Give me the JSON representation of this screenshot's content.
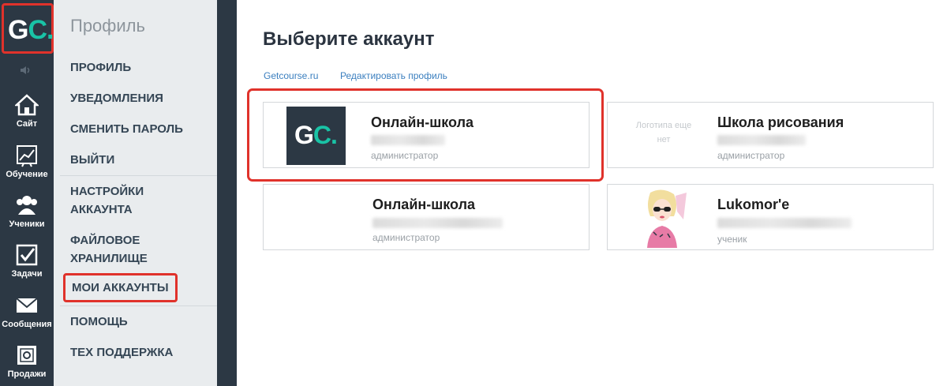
{
  "brand": {
    "logo_g": "G",
    "logo_c": "C",
    "logo_dot": ".",
    "accent": "#19c3a6",
    "highlight": "#e0322b"
  },
  "iconbar": {
    "items": [
      {
        "label": "Сайт",
        "icon": "home-icon"
      },
      {
        "label": "Обучение",
        "icon": "chart-icon"
      },
      {
        "label": "Ученики",
        "icon": "users-icon"
      },
      {
        "label": "Задачи",
        "icon": "checkbox-icon"
      },
      {
        "label": "Сообщения",
        "icon": "envelope-icon"
      },
      {
        "label": "Продажи",
        "icon": "safe-icon"
      }
    ]
  },
  "submenu": {
    "title": "Профиль",
    "items": [
      {
        "label": "ПРОФИЛЬ"
      },
      {
        "label": "УВЕДОМЛЕНИЯ"
      },
      {
        "label": "СМЕНИТЬ ПАРОЛЬ"
      },
      {
        "label": "ВЫЙТИ"
      },
      {
        "label": "НАСТРОЙКИ АККАУНТА"
      },
      {
        "label": "ФАЙЛОВОЕ ХРАНИЛИЩЕ"
      },
      {
        "label": "МОИ АККАУНТЫ"
      },
      {
        "label": "ПОМОЩЬ"
      },
      {
        "label": "ТЕХ ПОДДЕРЖКА"
      }
    ]
  },
  "main": {
    "title": "Выберите аккаунт",
    "links": [
      "Getcourse.ru",
      "Редактировать профиль"
    ],
    "accounts": [
      {
        "title": "Онлайн-школа",
        "role": "администратор",
        "logo": "gc-logo"
      },
      {
        "title": "Школа рисования",
        "role": "администратор",
        "logo_placeholder": "Логотипа еще нет"
      },
      {
        "title": "Онлайн-школа",
        "role": "администратор",
        "logo": "none"
      },
      {
        "title": "Lukomor'e",
        "role": "ученик",
        "logo": "avatar-image"
      }
    ]
  }
}
